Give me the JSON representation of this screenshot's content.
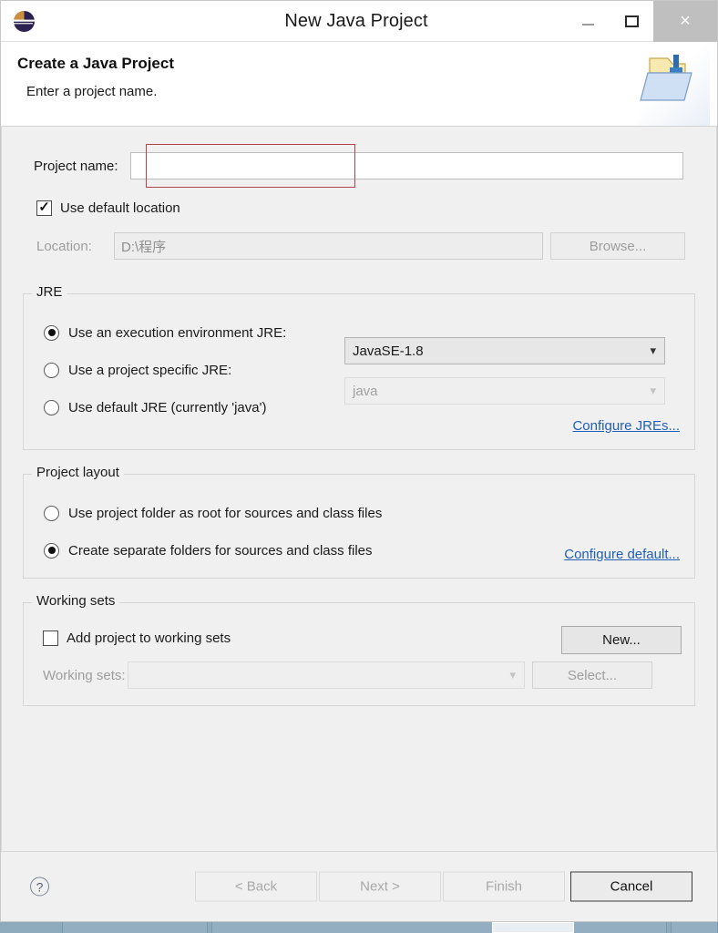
{
  "window": {
    "title": "New Java Project",
    "app_icon": "eclipse-logo-icon",
    "controls": {
      "minimize": "minimize-icon",
      "maximize": "maximize-icon",
      "close": "×"
    }
  },
  "header": {
    "title": "Create a Java Project",
    "subtitle": "Enter a project name.",
    "icon": "new-java-project-folder-icon"
  },
  "project_name": {
    "label": "Project name:",
    "value": "",
    "focus_highlight_color": "#b0444c"
  },
  "location": {
    "use_default_label": "Use default location",
    "use_default_checked": true,
    "label": "Location:",
    "value": "D:\\程序",
    "browse_label": "Browse...",
    "browse_enabled": false
  },
  "jre": {
    "legend": "JRE",
    "options": [
      {
        "label": "Use an execution environment JRE:",
        "selected": true
      },
      {
        "label": "Use a project specific JRE:",
        "selected": false
      },
      {
        "label": "Use default JRE (currently 'java')",
        "selected": false
      }
    ],
    "execution_env_value": "JavaSE-1.8",
    "specific_jre_value": "java",
    "specific_jre_enabled": false,
    "configure_link": "Configure JREs..."
  },
  "project_layout": {
    "legend": "Project layout",
    "options": [
      {
        "label": "Use project folder as root for sources and class files",
        "selected": false
      },
      {
        "label": "Create separate folders for sources and class files",
        "selected": true
      }
    ],
    "configure_link": "Configure default..."
  },
  "working_sets": {
    "legend": "Working sets",
    "add_label": "Add project to working sets",
    "add_checked": false,
    "new_label": "New...",
    "sets_label": "Working sets:",
    "sets_value": "",
    "select_label": "Select...",
    "select_enabled": false
  },
  "footer": {
    "help": "?",
    "buttons": [
      {
        "label": "< Back",
        "enabled": false
      },
      {
        "label": "Next >",
        "enabled": false
      },
      {
        "label": "Finish",
        "enabled": false
      },
      {
        "label": "Cancel",
        "enabled": true
      }
    ]
  },
  "colors": {
    "accent_link": "#1f5fb5",
    "dialog_bg": "#f0f0f0",
    "error_border": "#b0444c",
    "taskbar": "#8eaabd"
  }
}
